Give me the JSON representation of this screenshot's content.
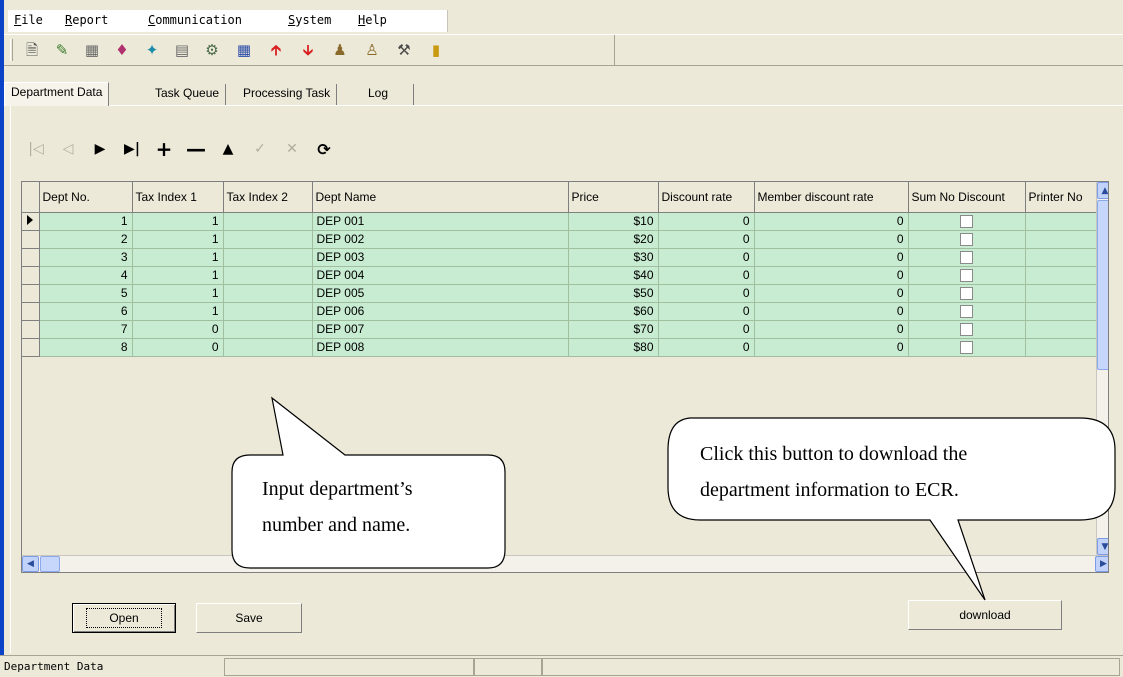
{
  "menu": [
    "File",
    "Report",
    "Communication",
    "System",
    "Help"
  ],
  "toolbar_icons": [
    "new-document-icon",
    "edit-icon",
    "report-icon",
    "tags-icon",
    "run-icon",
    "copy-icon",
    "settings-icon",
    "table-icon",
    "upload-arrow-icon",
    "download-arrow-icon",
    "users-icon",
    "users-group-icon",
    "tools-icon",
    "exit-icon"
  ],
  "tabs": [
    "Department Data",
    "Task Queue",
    "Processing Task",
    "Log"
  ],
  "active_tab": "Department Data",
  "navigator": [
    "first-record-icon",
    "prior-record-icon",
    "next-record-icon",
    "last-record-icon",
    "insert-record-icon",
    "delete-record-icon",
    "edit-record-icon",
    "post-record-icon",
    "cancel-record-icon",
    "refresh-icon"
  ],
  "grid": {
    "columns": [
      "Dept No.",
      "Tax Index 1",
      "Tax Index 2",
      "Dept Name",
      "Price",
      "Discount rate",
      "Member discount rate",
      "Sum No Discount",
      "Printer No"
    ],
    "rows": [
      {
        "dept_no": "1",
        "tax1": "1",
        "tax2": "",
        "name": "DEP 001",
        "price": "$10",
        "discount": "0",
        "member_discount": "0"
      },
      {
        "dept_no": "2",
        "tax1": "1",
        "tax2": "",
        "name": "DEP 002",
        "price": "$20",
        "discount": "0",
        "member_discount": "0"
      },
      {
        "dept_no": "3",
        "tax1": "1",
        "tax2": "",
        "name": "DEP 003",
        "price": "$30",
        "discount": "0",
        "member_discount": "0"
      },
      {
        "dept_no": "4",
        "tax1": "1",
        "tax2": "",
        "name": "DEP 004",
        "price": "$40",
        "discount": "0",
        "member_discount": "0"
      },
      {
        "dept_no": "5",
        "tax1": "1",
        "tax2": "",
        "name": "DEP 005",
        "price": "$50",
        "discount": "0",
        "member_discount": "0"
      },
      {
        "dept_no": "6",
        "tax1": "1",
        "tax2": "",
        "name": "DEP 006",
        "price": "$60",
        "discount": "0",
        "member_discount": "0"
      },
      {
        "dept_no": "7",
        "tax1": "0",
        "tax2": "",
        "name": "DEP 007",
        "price": "$70",
        "discount": "0",
        "member_discount": "0"
      },
      {
        "dept_no": "8",
        "tax1": "0",
        "tax2": "",
        "name": "DEP 008",
        "price": "$80",
        "discount": "0",
        "member_discount": "0"
      }
    ]
  },
  "buttons": {
    "open": "Open",
    "save": "Save",
    "download": "download"
  },
  "callouts": {
    "input_line1": "Input  department’s",
    "input_line2": "number and name.",
    "download_line1": "Click this button to download the",
    "download_line2": "department information to ECR."
  },
  "status": {
    "text": "Department Data"
  },
  "colors": {
    "row_bg": "#c8ecd2",
    "title_blue": "#0a43c8",
    "face": "#ece9d8"
  }
}
